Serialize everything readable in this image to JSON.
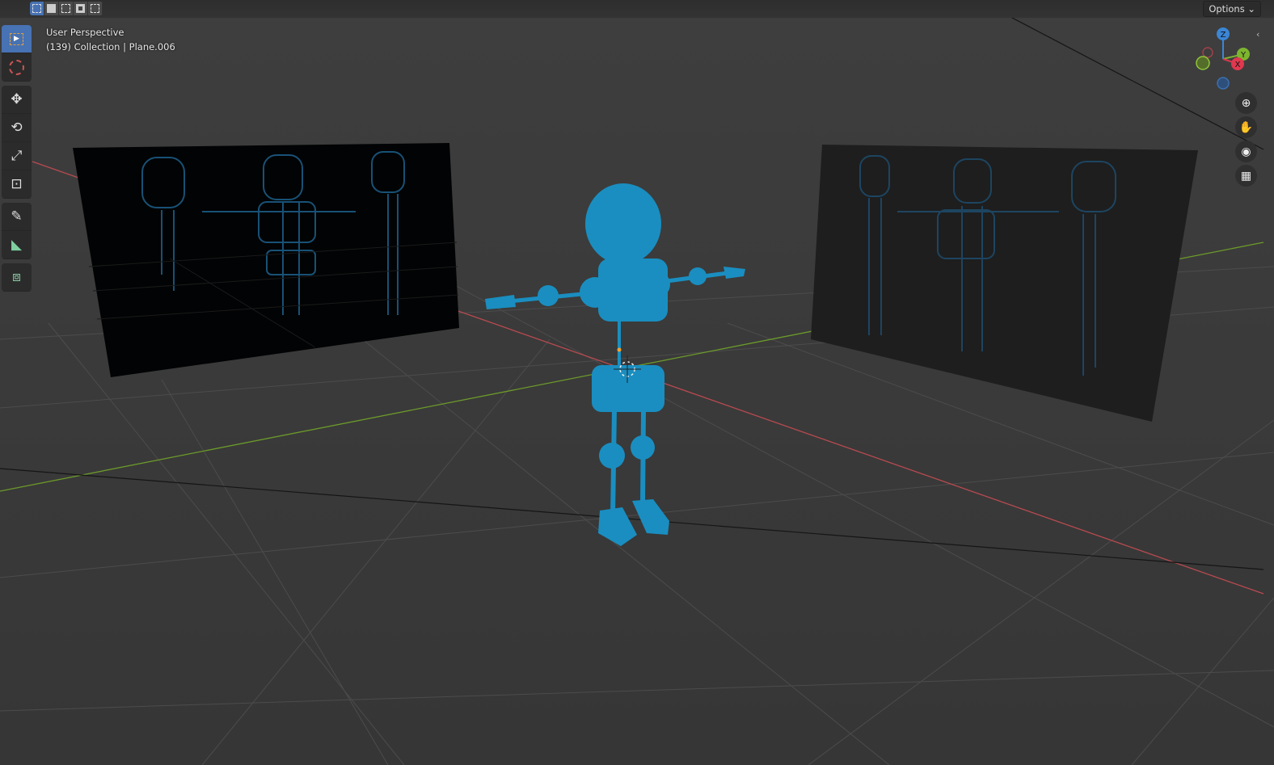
{
  "header": {
    "select_modes": [
      "new",
      "extend",
      "subtract",
      "difference",
      "intersect"
    ],
    "options_label": "Options",
    "options_chevron": "⌄"
  },
  "viewport": {
    "view_name": "User Perspective",
    "context": "(139) Collection | Plane.006"
  },
  "toolbar": {
    "tools": [
      "select-box",
      "cursor",
      "move",
      "rotate",
      "scale",
      "transform",
      "annotate",
      "measure",
      "add-cube"
    ]
  },
  "gizmo": {
    "z": "Z",
    "y": "Y",
    "x": "X"
  },
  "nav": {
    "collapse": "‹"
  },
  "colors": {
    "accent": "#4772b3",
    "figure": "#1a8ec0",
    "x_axis": "#c0474e",
    "y_axis": "#6c9a2a"
  }
}
